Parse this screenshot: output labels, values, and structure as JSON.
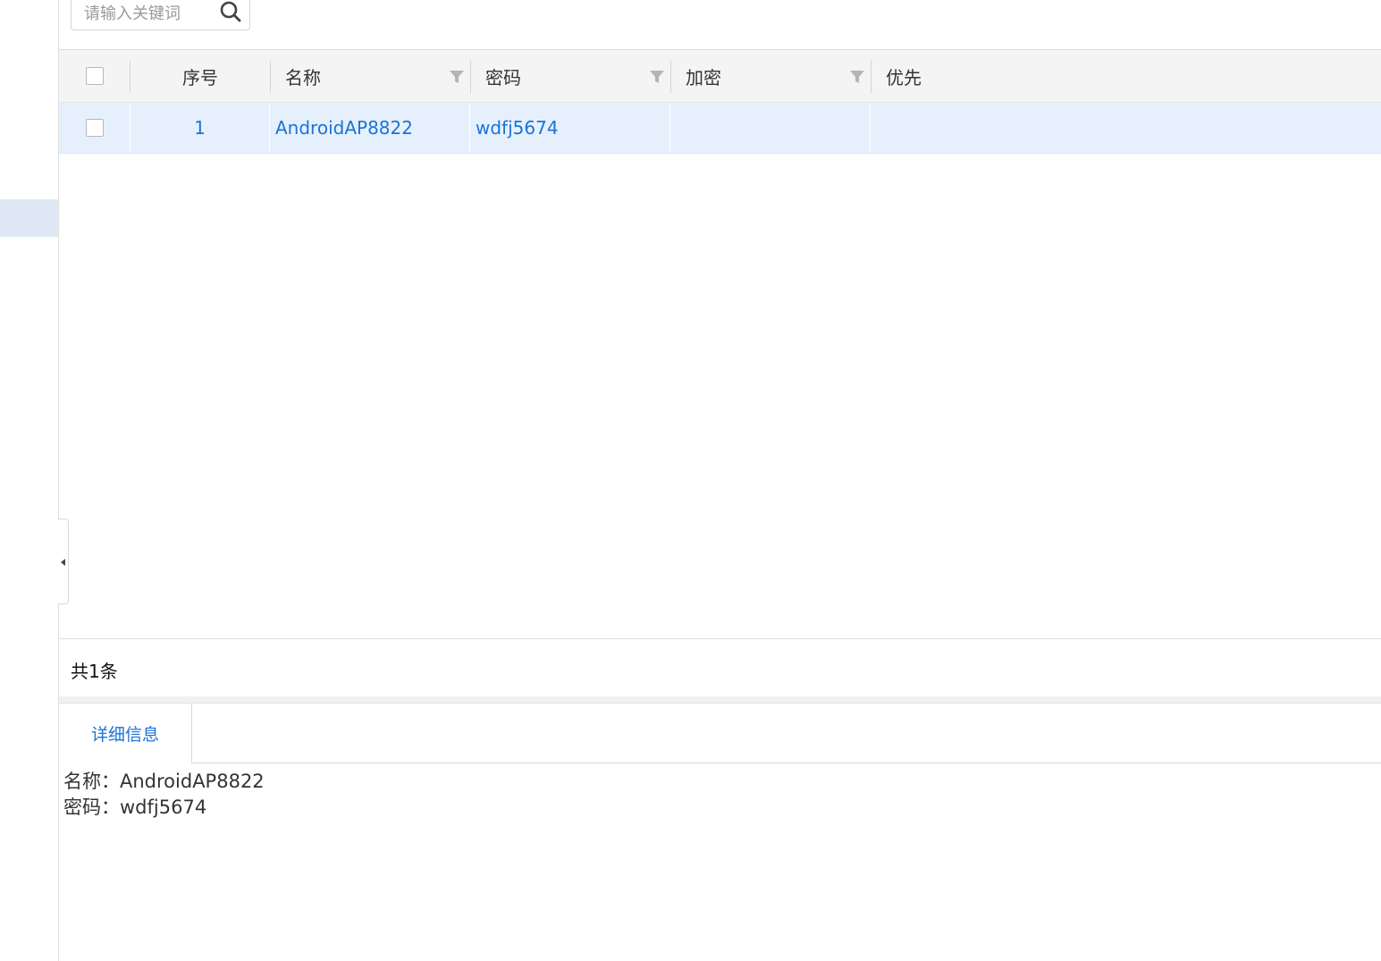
{
  "search": {
    "placeholder": "请输入关键词"
  },
  "table": {
    "columns": [
      {
        "label": "",
        "filter": false
      },
      {
        "label": "序号",
        "filter": false
      },
      {
        "label": "名称",
        "filter": true
      },
      {
        "label": "密码",
        "filter": true
      },
      {
        "label": "加密",
        "filter": true
      },
      {
        "label": "优先",
        "filter": false
      }
    ],
    "rows": [
      {
        "index": "1",
        "name": "AndroidAP8822",
        "password": "wdfj5674",
        "encryption": "",
        "priority": ""
      }
    ],
    "total_label": "共1条"
  },
  "tabs": [
    {
      "label": "详细信息",
      "active": true
    }
  ],
  "details": {
    "name_line": "名称：AndroidAP8822",
    "password_line": "密码：wdfj5674"
  },
  "colors": {
    "accent": "#1a73d8",
    "selected_row": "#e6f0fc",
    "header_bg": "#f4f4f4"
  }
}
